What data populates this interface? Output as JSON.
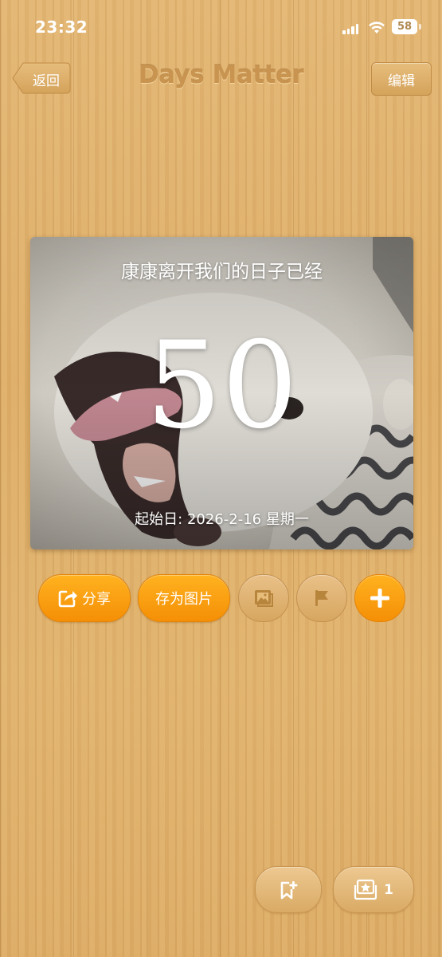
{
  "status_bar": {
    "time": "23:32",
    "battery": "58"
  },
  "nav": {
    "back_label": "返回",
    "title": "Days Matter",
    "edit_label": "编辑"
  },
  "card": {
    "title": "康康离开我们的日子已经",
    "days": "50",
    "start_date": "起始日: 2026-2-16 星期一"
  },
  "actions": {
    "share_label": "分享",
    "save_image_label": "存为图片",
    "icons": [
      "share-icon",
      "image-icon",
      "flag-icon",
      "plus-icon"
    ]
  },
  "bottom": {
    "count": "1",
    "icons": [
      "bookmark-add-icon",
      "photo-frame-icon"
    ]
  },
  "colors": {
    "accent": "#f7960b",
    "wood": "#dfb06b",
    "title": "#c8944f"
  }
}
